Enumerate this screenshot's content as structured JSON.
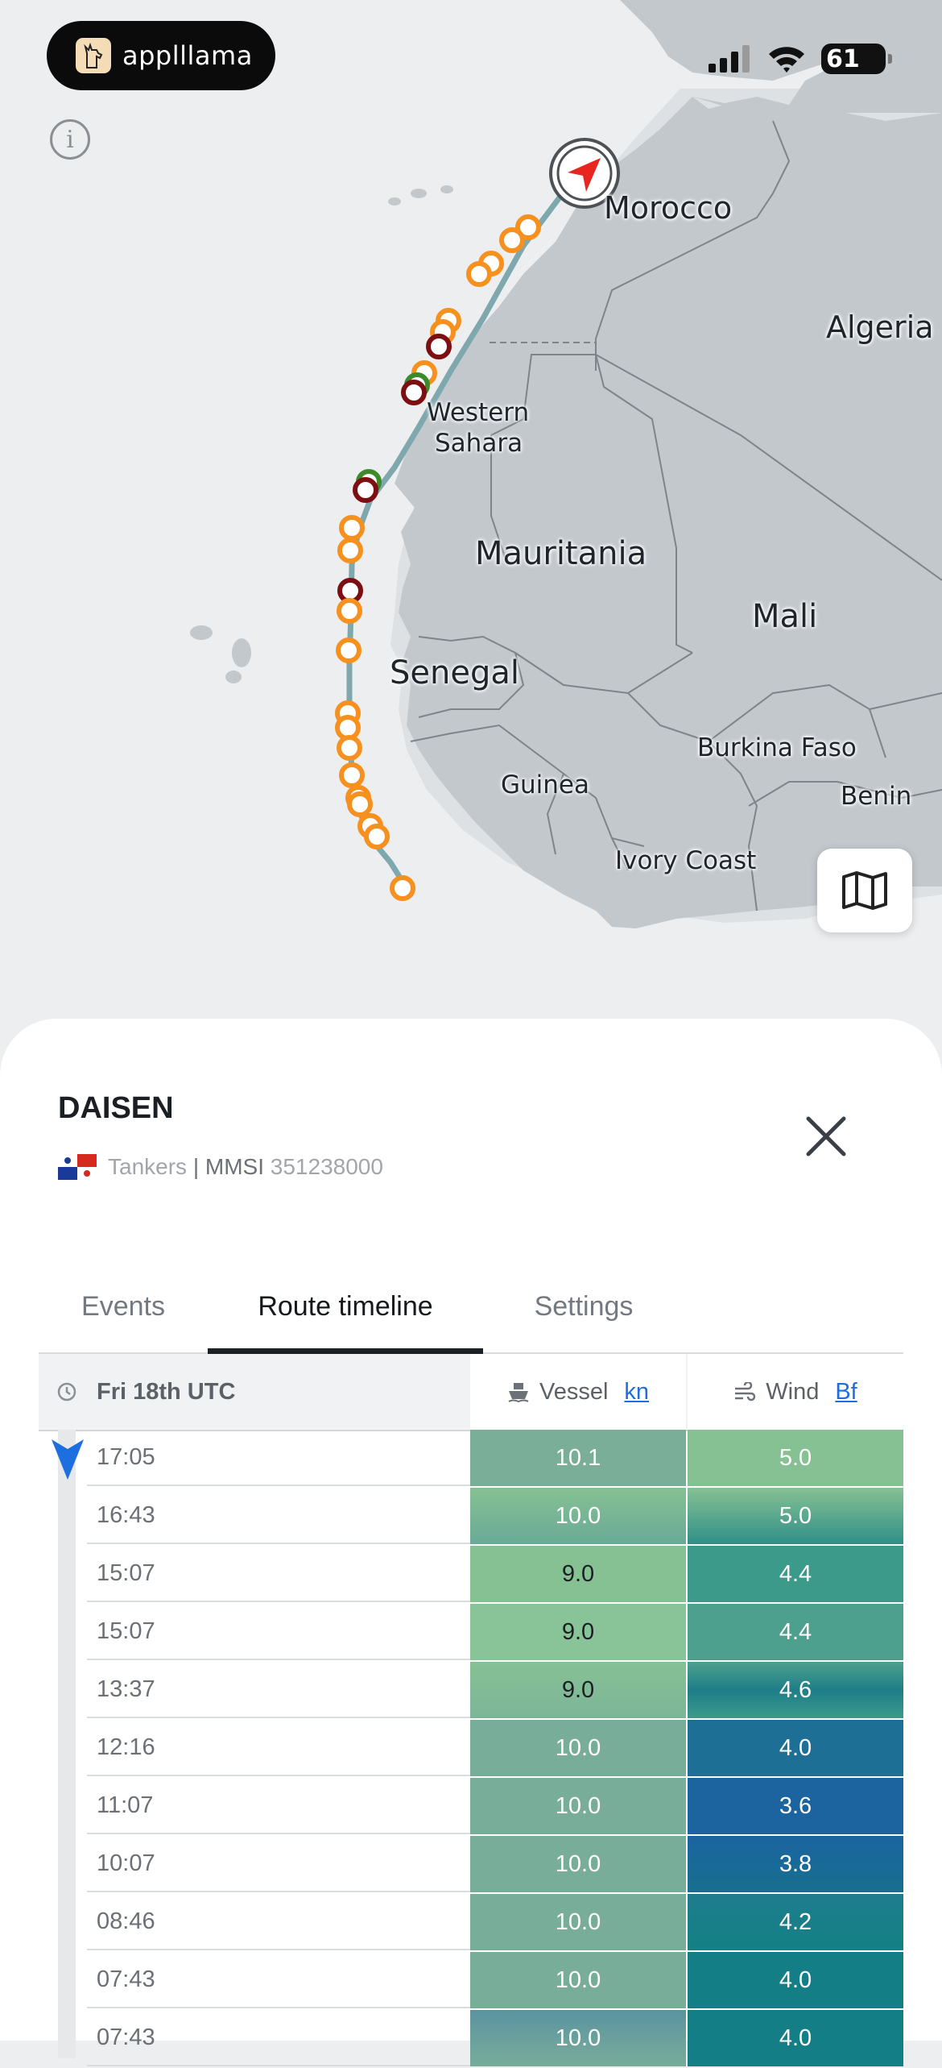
{
  "app": {
    "brand": "applllama"
  },
  "status_bar": {
    "battery": "61"
  },
  "map": {
    "labels": {
      "morocco": "Morocco",
      "algeria": "Algeria",
      "western_sahara_1": "Western",
      "western_sahara_2": "Sahara",
      "mauritania": "Mauritania",
      "mali": "Mali",
      "senegal": "Senegal",
      "burkina_faso": "Burkina Faso",
      "guinea": "Guinea",
      "benin": "Benin",
      "ivory_coast": "Ivory Coast"
    },
    "colors": {
      "land": "#c3c8cd",
      "sea": "#eceeef",
      "route": "#7fa7ae",
      "event_orange": "#f6901e",
      "event_red": "#7d0f12",
      "event_green": "#3c8a2a"
    }
  },
  "vessel": {
    "name": "DAISEN",
    "type": "Tankers",
    "mmsi_label": "MMSI",
    "mmsi": "351238000"
  },
  "tabs": [
    {
      "label": "Events"
    },
    {
      "label": "Route timeline"
    },
    {
      "label": "Settings"
    }
  ],
  "timeline": {
    "date_header": "Fri 18th UTC",
    "vessel_col": "Vessel",
    "vessel_unit": "kn",
    "wind_col": "Wind",
    "wind_unit": "Bf",
    "rows": [
      {
        "time": "17:05",
        "vessel": "10.1",
        "wind": "5.0"
      },
      {
        "time": "16:43",
        "vessel": "10.0",
        "wind": "5.0"
      },
      {
        "time": "15:07",
        "vessel": "9.0",
        "wind": "4.4"
      },
      {
        "time": "15:07",
        "vessel": "9.0",
        "wind": "4.4"
      },
      {
        "time": "13:37",
        "vessel": "9.0",
        "wind": "4.6"
      },
      {
        "time": "12:16",
        "vessel": "10.0",
        "wind": "4.0"
      },
      {
        "time": "11:07",
        "vessel": "10.0",
        "wind": "3.6"
      },
      {
        "time": "10:07",
        "vessel": "10.0",
        "wind": "3.8"
      },
      {
        "time": "08:46",
        "vessel": "10.0",
        "wind": "4.2"
      },
      {
        "time": "07:43",
        "vessel": "10.0",
        "wind": "4.0"
      },
      {
        "time": "07:43",
        "vessel": "10.0",
        "wind": "4.0"
      }
    ]
  }
}
